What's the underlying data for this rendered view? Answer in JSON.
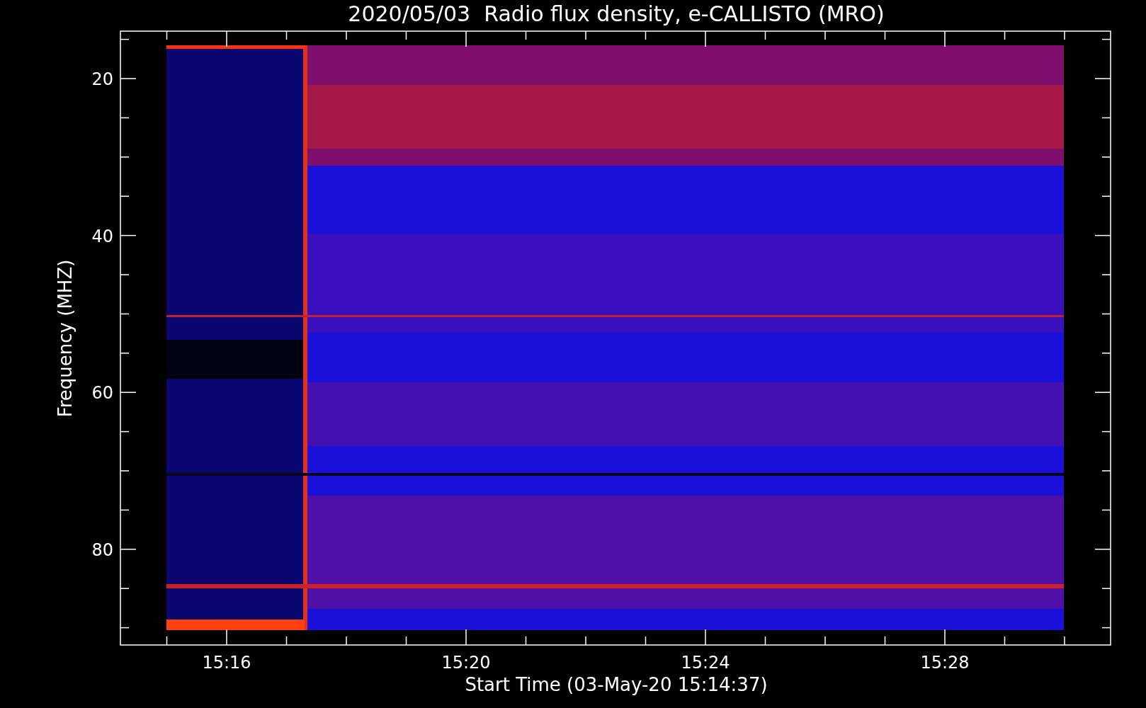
{
  "title": "2020/05/03  Radio flux density, e-CALLISTO (MRO)",
  "y_axis": {
    "label": "Frequency (MHZ)",
    "ticks": [
      "20",
      "40",
      "60",
      "80"
    ]
  },
  "x_axis": {
    "label": "Start Time (03-May-20 15:14:37)",
    "ticks": [
      "15:16",
      "15:20",
      "15:24",
      "15:28"
    ]
  }
}
